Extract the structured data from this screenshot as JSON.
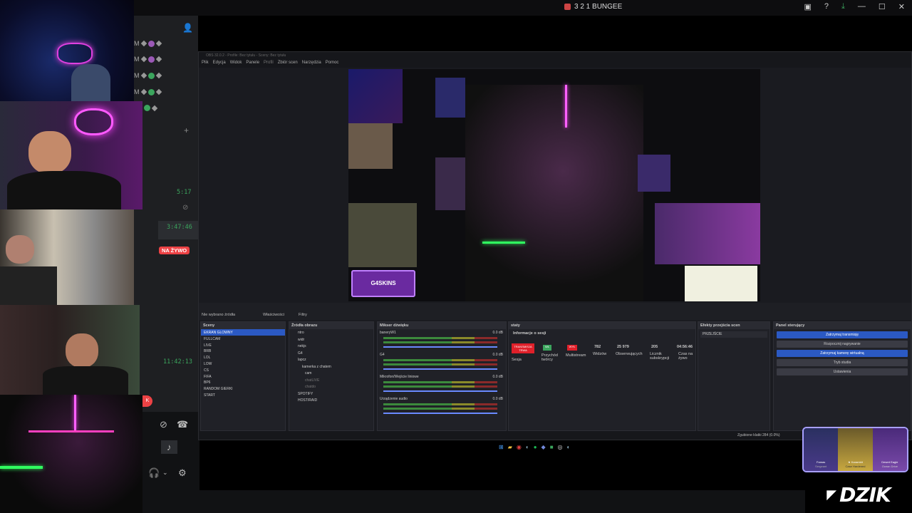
{
  "window": {
    "title": "3 2 1 BUNGEE"
  },
  "discord": {
    "timestamps": [
      "5:17",
      "3:47:46",
      "11:42:13"
    ],
    "live_badge": "NA ŻYWO",
    "m_letters": [
      "M",
      "M",
      "M",
      "M",
      "M"
    ]
  },
  "obs": {
    "title_line": "OBS 32.0.2 - Profile: Bez tytułu - Sceny: Bez tytułu",
    "menu": [
      "Plik",
      "Edycja",
      "Widok",
      "Panele",
      "Profil",
      "Zbiór scen",
      "Narzędzia",
      "Pomoc"
    ],
    "no_source": "Nie wybrano źródła",
    "properties": "Właściwości",
    "filters": "Filtry",
    "panels": {
      "scenes": "Sceny",
      "sources": "Źródła obrazu",
      "mixer": "Mikser dźwięku",
      "stats": "staty",
      "transitions": "Efekty przejścia scen",
      "controls": "Panel sterujący"
    },
    "scenes": [
      "EKRAN GLOWNY",
      "FULLCAM",
      "LIVE",
      "BRB",
      "LOL",
      "LOW",
      "CS",
      "FIFA",
      "BP6",
      "RANDOM GIERKI",
      "START"
    ],
    "sources": [
      "ntro",
      "widr",
      "nekjs",
      "G4",
      "lapcz",
      "kamerka z chatem",
      "cam",
      "chatLIVE",
      "chatdo",
      "SPOTIFY",
      "HOST/RAID"
    ],
    "mixer": [
      {
        "name": "baneryW1",
        "db": "0.0 dB"
      },
      {
        "name": "G4",
        "db": "0.0 dB"
      },
      {
        "name": "Mikrofon/Wejście liniowe",
        "db": "0.0 dB"
      },
      {
        "name": "Urządzenie audio",
        "db": "0.0 dB"
      }
    ],
    "session": {
      "header": "Informacje o sesji",
      "live_tag": "TRANSMISJA TRWA",
      "session_label": "Sesja",
      "on_tag": "WŁ",
      "income_label": "Przychód twórcy",
      "off_tag": "WYŁ",
      "multistream": "Multistream",
      "viewers_value": "782",
      "viewers_label": "Widzów",
      "followers_value": "25 979",
      "followers_label": "Obserwujących",
      "subs_value": "205",
      "subs_label": "Licznik subskrypcji",
      "time_value": "04:56:46",
      "time_label": "Czas na żywo"
    },
    "transition": "PRZEJŚCIE",
    "controls": [
      "Zatrzymaj transmisję",
      "Rozpocznij nagrywanie",
      "Zatrzymaj kamerę wirtualną",
      "Tryb studia",
      "Ustawienia"
    ],
    "status": "Zgubione klatki 284 (0.0%)"
  },
  "overlay": {
    "items": [
      {
        "name": "Famas",
        "sub": "Sergeant"
      },
      {
        "name": "★ Karambit",
        "sub": "Case Hardened"
      },
      {
        "name": "Desert Eagle",
        "sub": "Ocean Drive"
      }
    ],
    "logo": "DZIK"
  }
}
